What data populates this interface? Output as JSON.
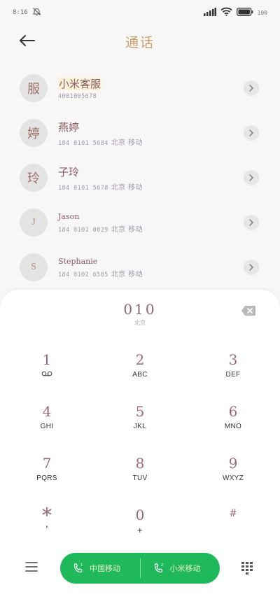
{
  "status_bar": {
    "time": "8:16",
    "battery_text": "100"
  },
  "header": {
    "title": "通话"
  },
  "contacts": [
    {
      "avatar": "服",
      "name": "小米客服",
      "detail": "4001005678",
      "carrier": ""
    },
    {
      "avatar": "婷",
      "name": "燕婷",
      "detail": "184 0101 5684",
      "carrier": "北京 移动"
    },
    {
      "avatar": "玲",
      "name": "子玲",
      "detail": "184 0101 5678",
      "carrier": "北京 移动"
    },
    {
      "avatar": "J",
      "name": "Jason",
      "detail": "184 0101 0029",
      "carrier": "北京 移动"
    },
    {
      "avatar": "S",
      "name": "Stephanie",
      "detail": "184 0102 6585",
      "carrier": "北京 移动"
    }
  ],
  "dialer": {
    "number": "010",
    "location": "北京"
  },
  "keypad": {
    "keys": [
      {
        "digit": "1",
        "letters": ""
      },
      {
        "digit": "2",
        "letters": "ABC"
      },
      {
        "digit": "3",
        "letters": "DEF"
      },
      {
        "digit": "4",
        "letters": "GHI"
      },
      {
        "digit": "5",
        "letters": "JKL"
      },
      {
        "digit": "6",
        "letters": "MNO"
      },
      {
        "digit": "7",
        "letters": "PQRS"
      },
      {
        "digit": "8",
        "letters": "TUV"
      },
      {
        "digit": "9",
        "letters": "WXYZ"
      },
      {
        "digit": "*",
        "letters": ","
      },
      {
        "digit": "0",
        "letters": "+"
      },
      {
        "digit": "#",
        "letters": ""
      }
    ]
  },
  "call_buttons": {
    "sim1_label": "中国移动",
    "sim2_label": "小米移动"
  },
  "colors": {
    "accent_green": "#1fb85a",
    "title_gold": "#c7a16b"
  }
}
